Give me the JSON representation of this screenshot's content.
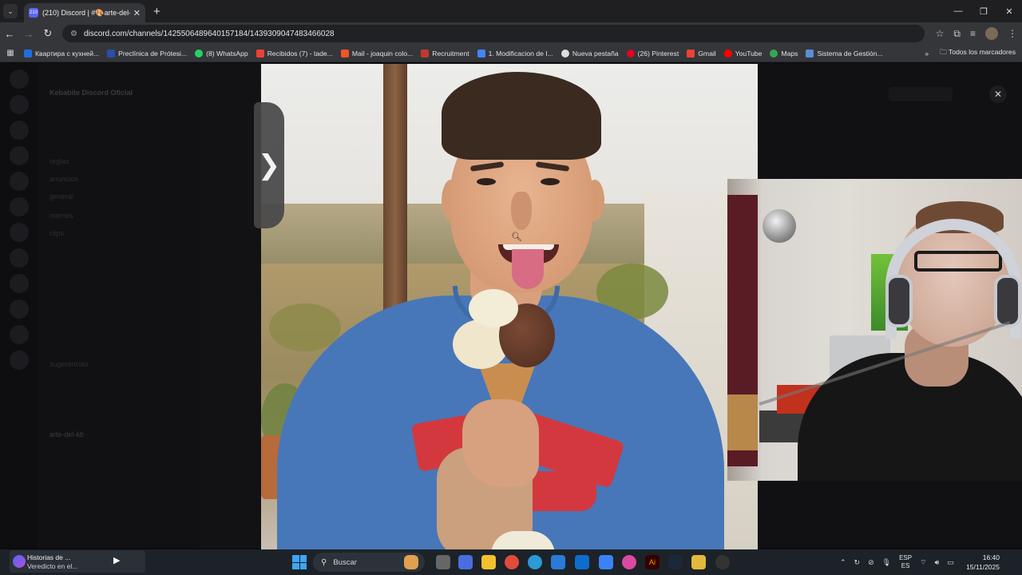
{
  "browser": {
    "tab_badge": "210",
    "tab_title": "(210) Discord | #🎨arte-del-kb",
    "tab_close": "✕",
    "new_tab": "+",
    "window_controls": [
      "—",
      "❐",
      "✕"
    ],
    "url": "discord.com/channels/1425506489640157184/1439309047483466028"
  },
  "bookmarks": [
    {
      "label": "Квартира с кухней...",
      "color": "#1f6fe0"
    },
    {
      "label": "Preclínica de Prótesi...",
      "color": "#2a4fa8"
    },
    {
      "label": "(8) WhatsApp",
      "color": "#25d366"
    },
    {
      "label": "Recibidos (7) - tade...",
      "color": "#e94335"
    },
    {
      "label": "Mail - joaquin colo...",
      "color": "#f35325"
    },
    {
      "label": "Recruitment",
      "color": "#c0392b"
    },
    {
      "label": "1. Modificacion de I...",
      "color": "#4285f4"
    },
    {
      "label": "Nueva pestaña",
      "color": "#dddddd"
    },
    {
      "label": "(26) Pinterest",
      "color": "#e60023"
    },
    {
      "label": "Gmail",
      "color": "#ea4335"
    },
    {
      "label": "YouTube",
      "color": "#ff0000"
    },
    {
      "label": "Maps",
      "color": "#34a853"
    },
    {
      "label": "Sistema de Gestión...",
      "color": "#5a8fd6"
    }
  ],
  "bookmarks_more": "»",
  "bookmarks_folder": "Todos los marcadores",
  "discord": {
    "server_name": "Kebabite Discord Oficial",
    "channels": [
      "reglas",
      "anuncios",
      "general",
      "memes",
      "clips",
      "sugerencias",
      "arte-del-kb"
    ],
    "active_channel": "arte-del-kb"
  },
  "viewer": {
    "prev_label": "❯",
    "close_label": "✕"
  },
  "taskbar": {
    "media_title": "Historias de ...",
    "media_subtitle": "Veredicto en el...",
    "search_placeholder": "Buscar",
    "lang_top": "ESP",
    "lang_bottom": "ES",
    "time": "16:40",
    "date": "15/11/2025"
  }
}
